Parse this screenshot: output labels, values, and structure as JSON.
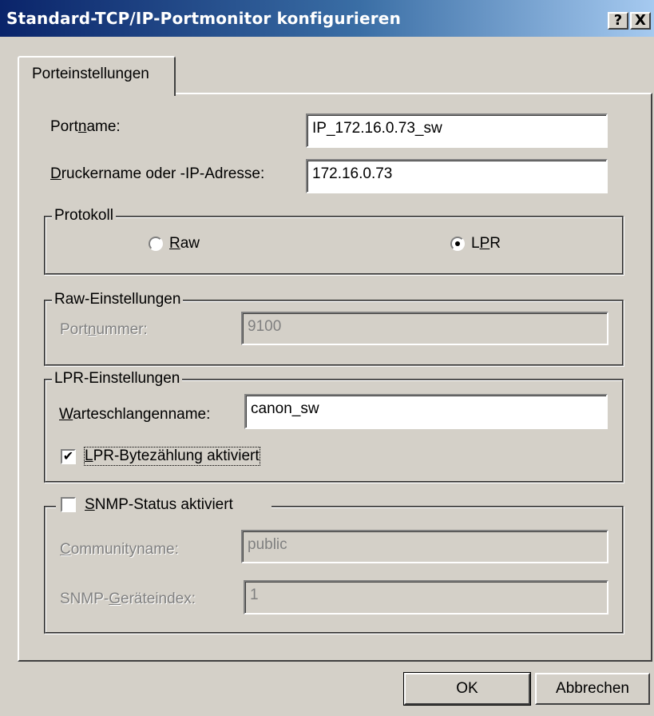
{
  "window": {
    "title": "Standard-TCP/IP-Portmonitor konfigurieren",
    "help_label": "?",
    "close_label": "X"
  },
  "tabs": [
    {
      "label": "Porteinstellungen"
    }
  ],
  "port_name": {
    "label_pre": "Port",
    "label_key": "n",
    "label_post": "ame:",
    "value": "IP_172.16.0.73_sw"
  },
  "printer_address": {
    "label_key": "D",
    "label_post": "ruckername oder -IP-Adresse:",
    "value": "172.16.0.73"
  },
  "protocol": {
    "legend": "Protokoll",
    "raw": {
      "label_key": "R",
      "label_post": "aw",
      "selected": false
    },
    "lpr": {
      "label_pre": "L",
      "label_key": "P",
      "label_post": "R",
      "selected": true
    }
  },
  "raw_settings": {
    "legend": "Raw-Einstellungen",
    "port_number": {
      "label_pre": "Port",
      "label_key": "n",
      "label_post": "ummer:",
      "value": "9100",
      "enabled": false
    }
  },
  "lpr_settings": {
    "legend": "LPR-Einstellungen",
    "queue_name": {
      "label_key": "W",
      "label_post": "arteschlangenname:",
      "value": "canon_sw"
    },
    "byte_counting": {
      "label_key": "L",
      "label_post": "PR-Bytezählung aktiviert",
      "checked": true
    }
  },
  "snmp": {
    "label_key": "S",
    "label_post": "NMP-Status aktiviert",
    "checked": false,
    "community": {
      "label_key": "C",
      "label_post": "ommunityname:",
      "value": "public",
      "enabled": false
    },
    "device_index": {
      "label_pre": "SNMP-",
      "label_key": "G",
      "label_post": "eräteindex:",
      "value": "1",
      "enabled": false
    }
  },
  "buttons": {
    "ok": "OK",
    "cancel": "Abbrechen"
  }
}
